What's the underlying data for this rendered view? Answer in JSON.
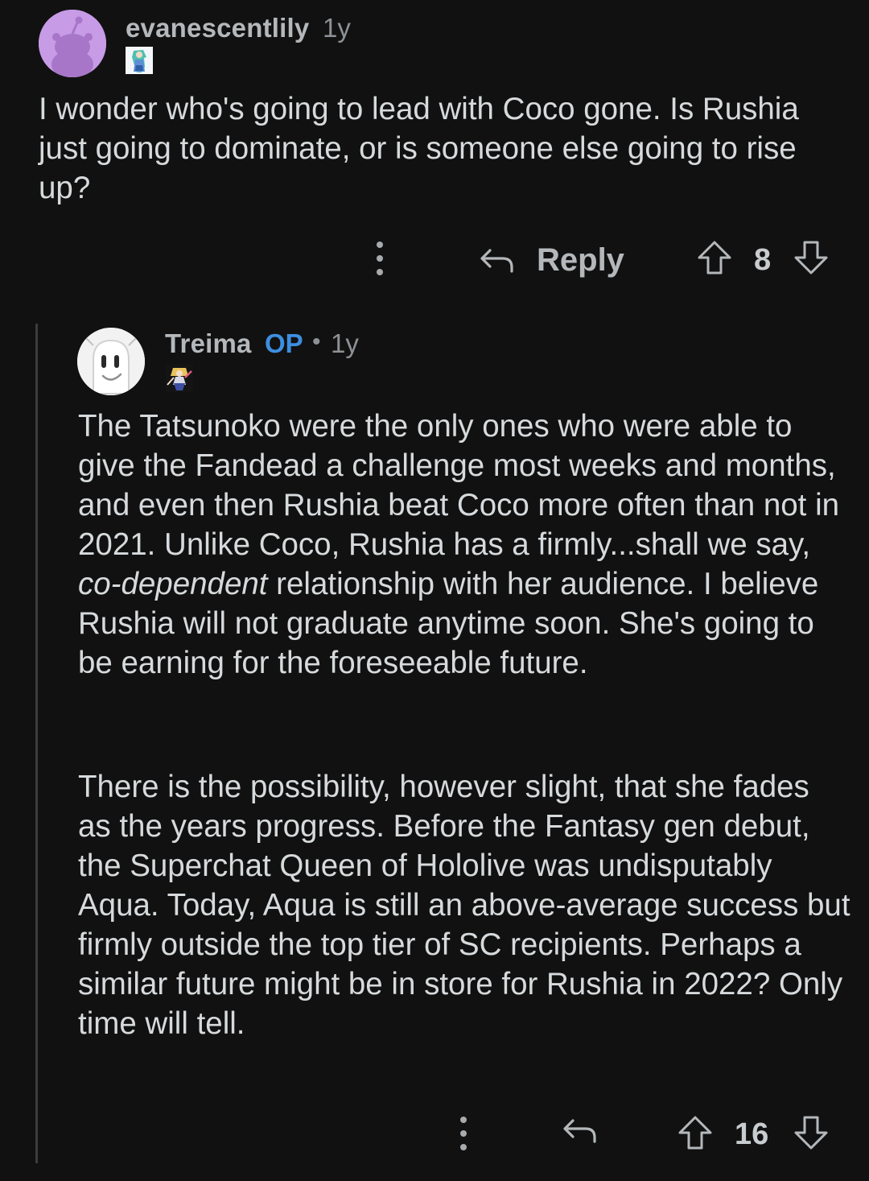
{
  "comments": [
    {
      "username": "evanescentlily",
      "time": "1y",
      "body": "I wonder who's going to lead with Coco gone. Is Rushia just going to dominate, or is someone else going to rise up?",
      "reply_label": "Reply",
      "votes": "8",
      "icons": {
        "avatar": "snoo-avatar",
        "flair": "character-flair-icon",
        "more": "more-options-icon",
        "reply": "reply-arrow-icon",
        "upvote": "upvote-arrow-icon",
        "downvote": "downvote-arrow-icon"
      }
    },
    {
      "username": "Treima",
      "op_badge": "OP",
      "separator": "•",
      "time": "1y",
      "paragraph1_part1": "The Tatsunoko were the only ones who were able to give the Fandead a challenge most weeks and months, and even then Rushia beat Coco more often than not in 2021. Unlike Coco, Rushia has a firmly...shall we say, ",
      "paragraph1_emphasis": "co-dependent",
      "paragraph1_part2": " relationship with her audience. I believe Rushia will not graduate anytime soon. She's going to be earning for the foreseeable future.",
      "paragraph2": "There is the possibility, however slight, that she fades as the years progress. Before the Fantasy gen debut, the Superchat Queen of Hololive was undisputably Aqua. Today, Aqua is still an above-average success but firmly outside the top tier of SC recipients. Perhaps a similar future might be in store for Rushia in 2022? Only time will tell.",
      "votes": "16",
      "icons": {
        "avatar": "ghost-avatar",
        "flair": "character-flair-icon",
        "more": "more-options-icon",
        "reply": "reply-arrow-icon",
        "upvote": "upvote-arrow-icon",
        "downvote": "downvote-arrow-icon"
      }
    }
  ],
  "colors": {
    "background": "#111111",
    "text": "#d7dadc",
    "username": "#b4b8bb",
    "op_badge": "#3d8fe0",
    "avatar1_bg": "#c79be6",
    "thread_line": "#3a3c3e"
  }
}
